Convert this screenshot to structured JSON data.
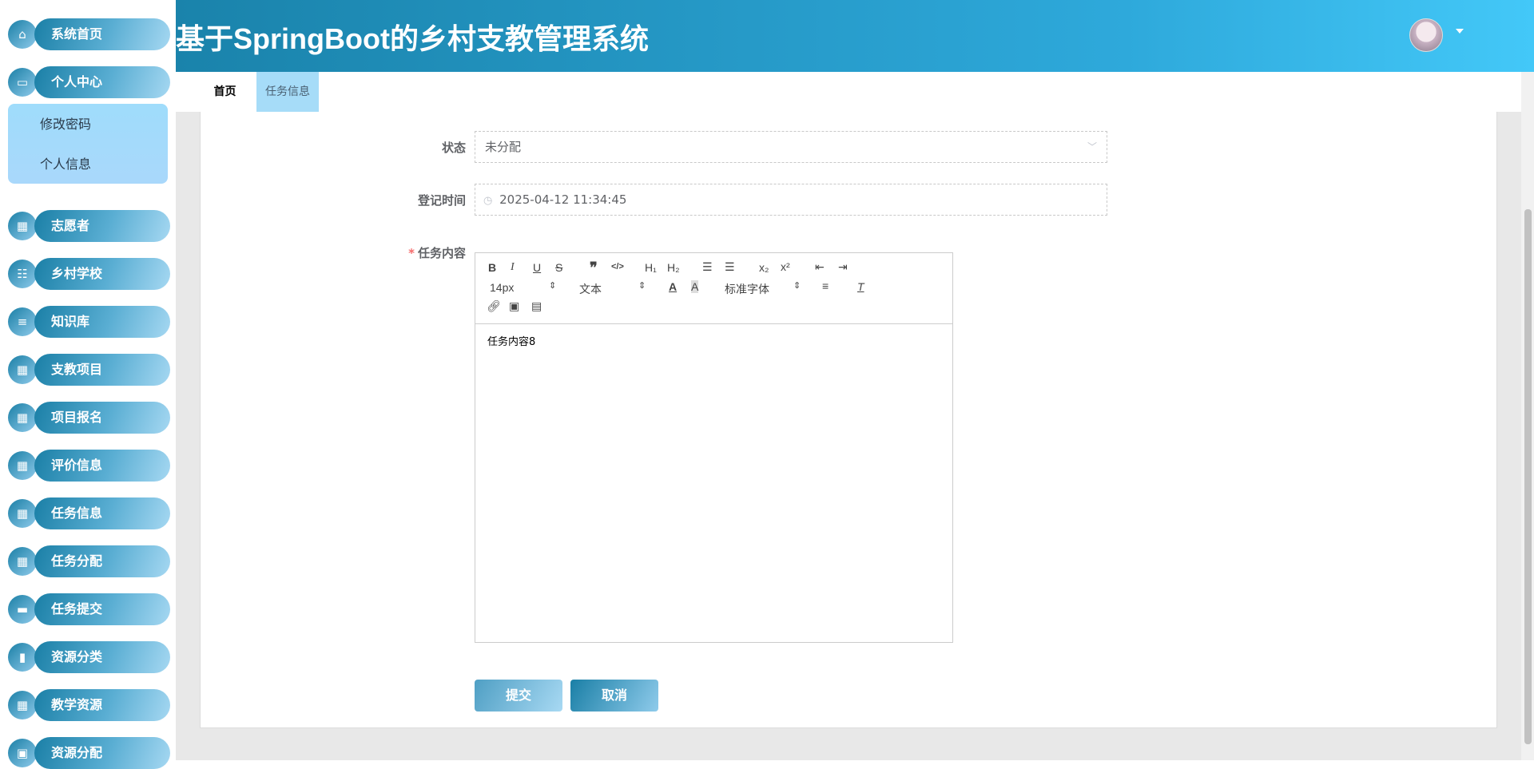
{
  "header": {
    "title": "基于SpringBoot的乡村支教管理系统",
    "avatar": "user-avatar"
  },
  "sidebar": {
    "items": [
      {
        "label": "系统首页",
        "icon": "home-icon"
      },
      {
        "label": "个人中心",
        "icon": "wallet-icon"
      },
      {
        "label": "志愿者",
        "icon": "grid-icon"
      },
      {
        "label": "乡村学校",
        "icon": "sliders-icon"
      },
      {
        "label": "知识库",
        "icon": "menu-icon"
      },
      {
        "label": "支教项目",
        "icon": "grid-icon"
      },
      {
        "label": "项目报名",
        "icon": "grid-icon"
      },
      {
        "label": "评价信息",
        "icon": "grid-icon"
      },
      {
        "label": "任务信息",
        "icon": "grid-icon"
      },
      {
        "label": "任务分配",
        "icon": "grid-icon"
      },
      {
        "label": "任务提交",
        "icon": "monitor-icon"
      },
      {
        "label": "资源分类",
        "icon": "bar-chart-icon"
      },
      {
        "label": "教学资源",
        "icon": "grid-icon"
      },
      {
        "label": "资源分配",
        "icon": "clipboard-icon"
      }
    ],
    "submenu": [
      "修改密码",
      "个人信息"
    ]
  },
  "tabs": [
    {
      "label": "首页"
    },
    {
      "label": "任务信息"
    }
  ],
  "form": {
    "status_label": "状态",
    "status_value": "未分配",
    "time_label": "登记时间",
    "time_value": "2025-04-12 11:34:45",
    "content_label": "任务内容",
    "required_mark": "*",
    "content_value": "任务内容8"
  },
  "editor": {
    "font_size": "14px",
    "header_select": "文本",
    "font_family": "标准字体"
  },
  "buttons": {
    "submit": "提交",
    "cancel": "取消"
  },
  "colors": {
    "accent": "#1a83ab",
    "accent_light": "#a6d8f2",
    "tab_active_bg": "#a6dcf8"
  }
}
